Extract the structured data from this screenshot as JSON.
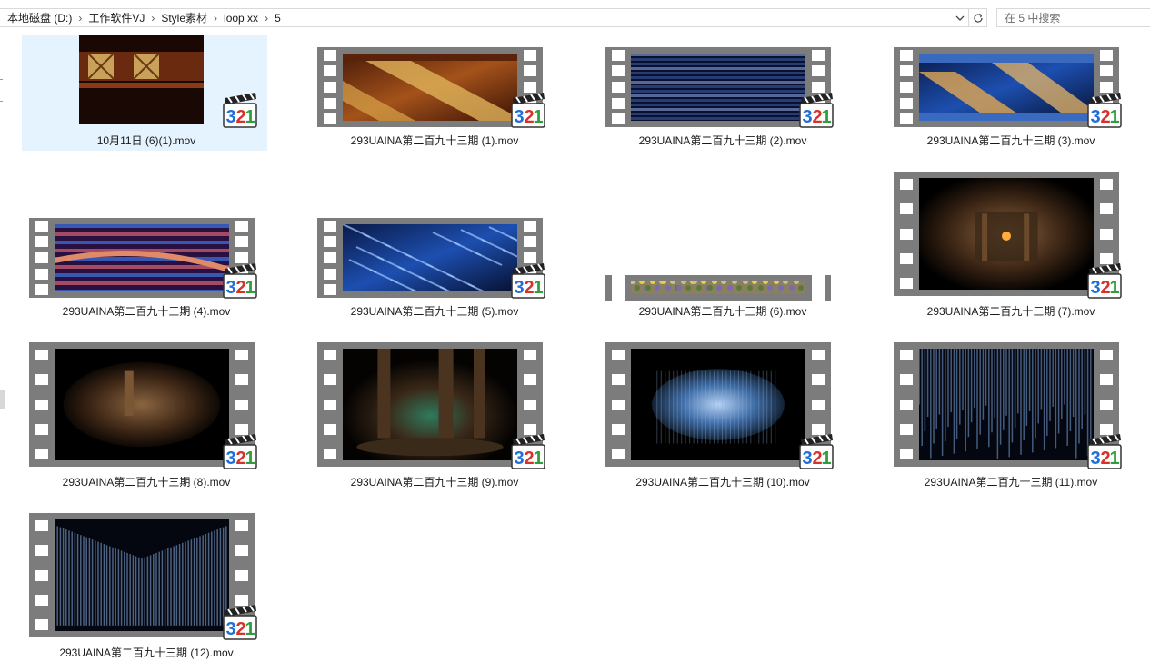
{
  "breadcrumb": [
    "本地磁盘 (D:)",
    "工作软件VJ",
    "Style素材",
    "loop xx",
    "5"
  ],
  "search": {
    "placeholder": "在 5 中搜索"
  },
  "icons": {
    "breadcrumb_separator": "chevron-right-icon",
    "address_dropdown": "chevron-down-icon",
    "refresh": "refresh-icon",
    "file_overlay": "media-player-classic-321-icon"
  },
  "colors": {
    "selection": "#e5f3ff",
    "film": "#7c7c7c",
    "badge_3": "#1e6fd9",
    "badge_2": "#d6312b",
    "badge_1": "#2f9e3d"
  },
  "badge_digits": [
    "3",
    "2",
    "1"
  ],
  "files": [
    {
      "name": "10月11日 (6)(1).mov",
      "selected": true,
      "thumb": "gold-wood-panels"
    },
    {
      "name": "293UAINA第二百九十三期 (1).mov",
      "thumb": "gold-diagonal-wood"
    },
    {
      "name": "293UAINA第二百九十三期 (2).mov",
      "thumb": "blue-glitch"
    },
    {
      "name": "293UAINA第二百九十三期 (3).mov",
      "thumb": "blue-gold-diagonal"
    },
    {
      "name": "293UAINA第二百九十三期 (4).mov",
      "thumb": "red-blue-stripes"
    },
    {
      "name": "293UAINA第二百九十三期 (5).mov",
      "thumb": "blue-streaks"
    },
    {
      "name": "293UAINA第二百九十三期 (6).mov",
      "thumb": "flower-field-strip"
    },
    {
      "name": "293UAINA第二百九十三期 (7).mov",
      "thumb": "dark-temple"
    },
    {
      "name": "293UAINA第二百九十三期 (8).mov",
      "thumb": "brown-ruins"
    },
    {
      "name": "293UAINA第二百九十三期 (9).mov",
      "thumb": "temple-pillars"
    },
    {
      "name": "293UAINA第二百九十三期 (10).mov",
      "thumb": "blue-wave"
    },
    {
      "name": "293UAINA第二百九十三期 (11).mov",
      "thumb": "blue-rain"
    },
    {
      "name": "293UAINA第二百九十三期 (12).mov",
      "thumb": "blue-v-rain"
    }
  ]
}
